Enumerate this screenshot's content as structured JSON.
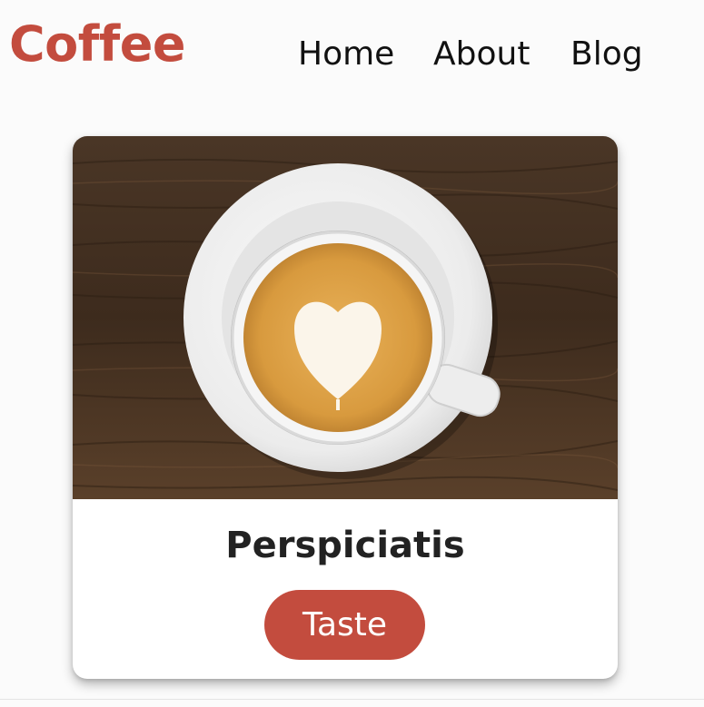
{
  "header": {
    "brand": "Coffee",
    "nav": [
      {
        "label": "Home"
      },
      {
        "label": "About"
      },
      {
        "label": "Blog"
      }
    ]
  },
  "card": {
    "image_icon": "latte-art-heart-cup-image",
    "title": "Perspiciatis",
    "button_label": "Taste"
  },
  "colors": {
    "brand": "#c34c3e",
    "button": "#c34c3e"
  }
}
